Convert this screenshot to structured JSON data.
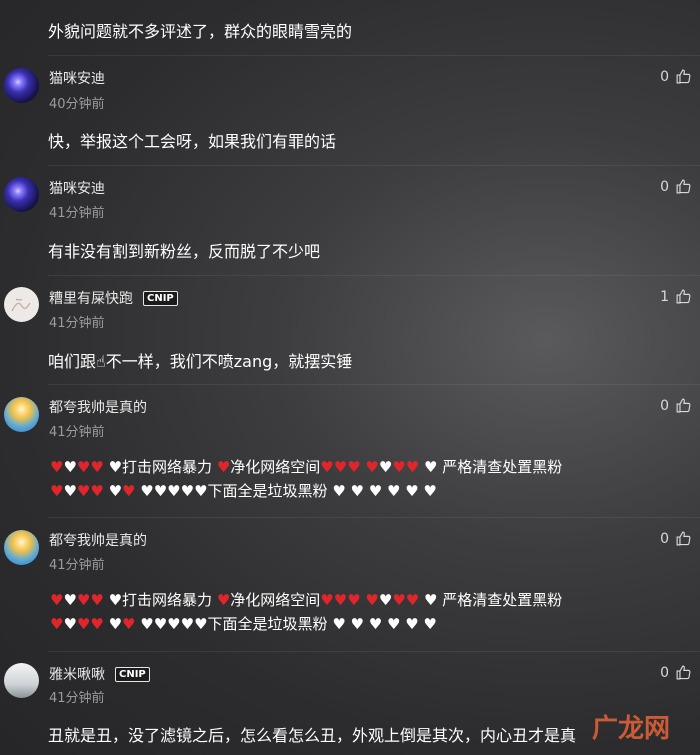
{
  "comments": [
    {
      "content": "外貌问题就不多评述了，群众的眼睛雪亮的"
    },
    {
      "username": "猫咪安迪",
      "time": "40分钟前",
      "likes": "0",
      "content": "快，举报这个工会呀，如果我们有罪的话"
    },
    {
      "username": "猫咪安迪",
      "time": "41分钟前",
      "likes": "0",
      "content": "有非没有割到新粉丝，反而脱了不少吧"
    },
    {
      "username": "糟里有屎快跑",
      "badge": "CNIP",
      "time": "41分钟前",
      "likes": "1",
      "content": "咱们跟☝不一样，我们不喷zang，就摆实锤"
    },
    {
      "username": "都夸我帅是真的",
      "time": "41分钟前",
      "likes": "0",
      "line1_a": "♥打击网络暴力",
      "line1_b": "净化网络空间",
      "line1_c": "♥ 严格清查处置黑粉",
      "line2_a": "下面全是垃圾黑粉"
    },
    {
      "username": "都夸我帅是真的",
      "time": "41分钟前",
      "likes": "0",
      "line1_a": "♥打击网络暴力",
      "line1_b": "净化网络空间",
      "line1_c": "♥ 严格清查处置黑粉",
      "line2_a": "下面全是垃圾黑粉"
    },
    {
      "username": "雅米啾啾",
      "badge": "CNIP",
      "time": "41分钟前",
      "likes": "0",
      "content": "丑就是丑，没了滤镜之后，怎么看怎么丑，外观上倒是其次，内心丑才是真"
    }
  ],
  "watermark": {
    "main": "广龙网",
    "sub": ""
  }
}
